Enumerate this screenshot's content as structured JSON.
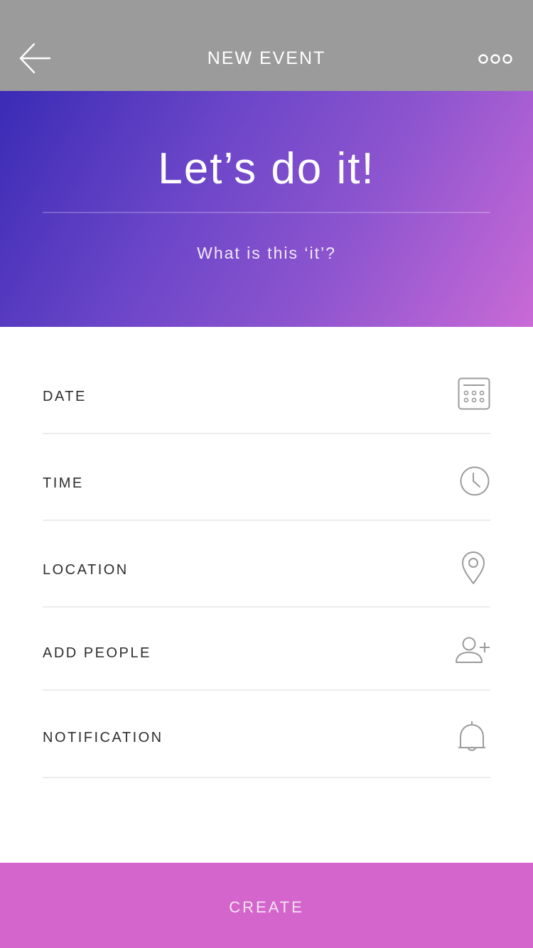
{
  "header": {
    "title": "NEW EVENT",
    "back_icon": "arrow-left-icon",
    "more_icon": "more-dots-icon",
    "background": "#9b9b9b"
  },
  "hero": {
    "title": "Let’s do it!",
    "input_value": "",
    "input_placeholder": "What is this ‘it’?",
    "gradient_start": "#3a2bb5",
    "gradient_end": "#c96ad6"
  },
  "fields": [
    {
      "label": "DATE",
      "icon": "calendar-icon"
    },
    {
      "label": "TIME",
      "icon": "clock-icon"
    },
    {
      "label": "LOCATION",
      "icon": "location-pin-icon"
    },
    {
      "label": "ADD PEOPLE",
      "icon": "add-person-icon"
    },
    {
      "label": "NOTIFICATION",
      "icon": "bell-icon"
    }
  ],
  "create_button": {
    "label": "CREATE",
    "color": "#d465cc"
  }
}
